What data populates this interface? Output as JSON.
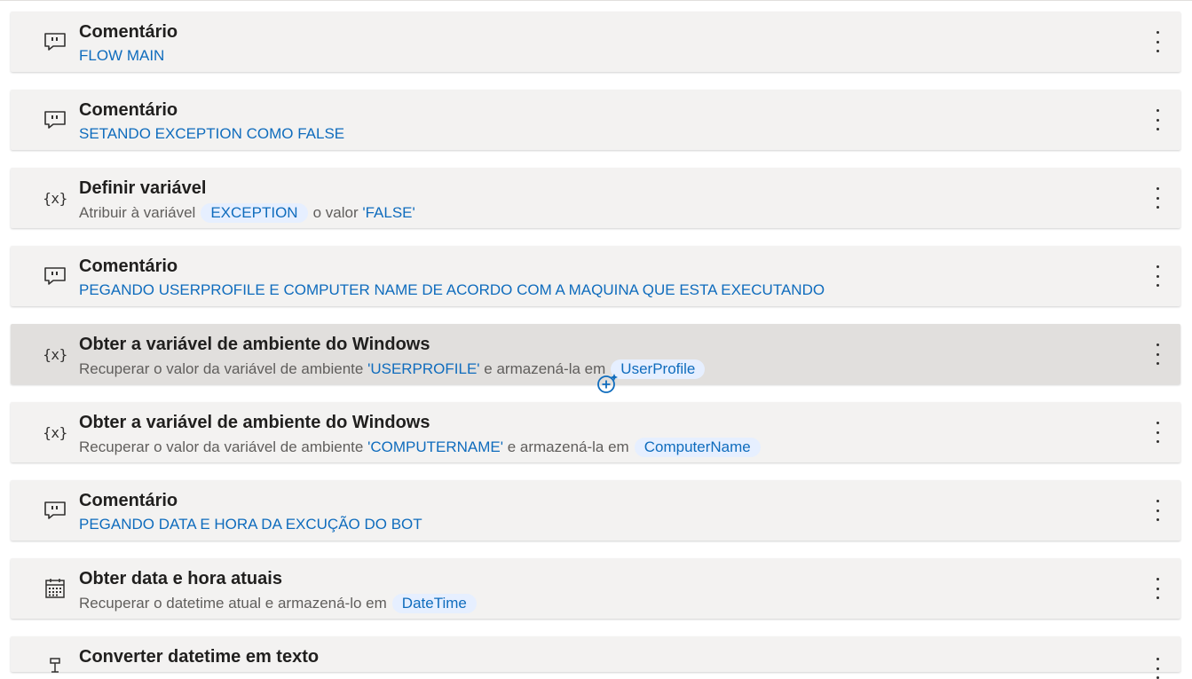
{
  "actions": [
    {
      "title": "Comentário",
      "icon": "comment-icon",
      "comment": "FLOW MAIN"
    },
    {
      "title": "Comentário",
      "icon": "comment-icon",
      "comment": "SETANDO EXCEPTION COMO FALSE"
    },
    {
      "title": "Definir variável",
      "icon": "variable-icon",
      "pre": "Atribuir à variável",
      "var": "EXCEPTION",
      "mid": "o valor",
      "literal": "'FALSE'"
    },
    {
      "title": "Comentário",
      "icon": "comment-icon",
      "comment": "PEGANDO USERPROFILE E COMPUTER NAME DE ACORDO COM A MAQUINA QUE ESTA EXECUTANDO"
    },
    {
      "title": "Obter a variável de ambiente do Windows",
      "icon": "variable-icon",
      "pre": "Recuperar o valor da variável de ambiente",
      "literal": "'USERPROFILE'",
      "mid": "e armazená-la em",
      "var": "UserProfile",
      "selected": true
    },
    {
      "title": "Obter a variável de ambiente do Windows",
      "icon": "variable-icon",
      "pre": "Recuperar o valor da variável de ambiente",
      "literal": "'COMPUTERNAME'",
      "mid": "e armazená-la em",
      "var": "ComputerName"
    },
    {
      "title": "Comentário",
      "icon": "comment-icon",
      "comment": "PEGANDO DATA E HORA DA EXCUÇÃO DO BOT"
    },
    {
      "title": "Obter data e hora atuais",
      "icon": "calendar-icon",
      "pre": "Recuperar o datetime atual e armazená-lo em",
      "var": "DateTime"
    },
    {
      "title": "Converter datetime em texto",
      "icon": "convert-icon"
    }
  ],
  "variable_glyph": "{x}",
  "colors": {
    "accent": "#0f6cbd",
    "card": "#f3f2f1",
    "selected": "#e1dfdd",
    "var_bg": "#e6efff"
  }
}
